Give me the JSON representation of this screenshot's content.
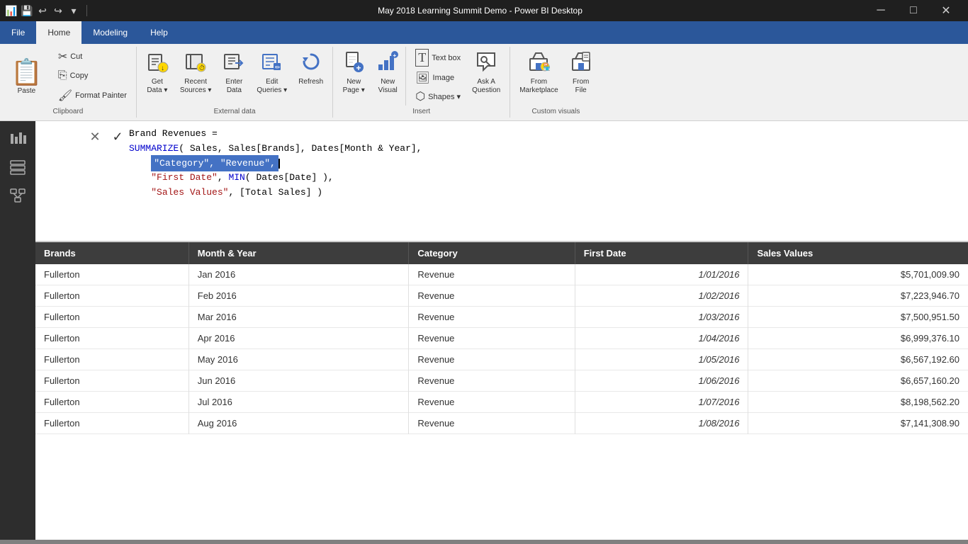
{
  "titleBar": {
    "title": "May 2018 Learning Summit Demo - Power BI Desktop",
    "icons": [
      "📊",
      "💾",
      "↩",
      "↪",
      "▾"
    ],
    "controls": [
      "—",
      "□",
      "✕"
    ]
  },
  "ribbon": {
    "tabs": [
      {
        "label": "File",
        "active": false
      },
      {
        "label": "Home",
        "active": true
      },
      {
        "label": "Modeling",
        "active": false
      },
      {
        "label": "Help",
        "active": false
      }
    ],
    "groups": {
      "clipboard": {
        "label": "Clipboard",
        "paste": "Paste",
        "cut": "✂ Cut",
        "copy": "⎘ Copy",
        "formatPainter": "🖌 Format Painter"
      },
      "externalData": {
        "label": "External data",
        "buttons": [
          {
            "icon": "📄",
            "label": "Get\nData ▾"
          },
          {
            "icon": "🕐",
            "label": "Recent\nSources ▾"
          },
          {
            "icon": "↵",
            "label": "Enter\nData"
          },
          {
            "icon": "✏️",
            "label": "Edit\nQueries ▾"
          },
          {
            "icon": "🔄",
            "label": "Refresh"
          }
        ]
      },
      "insert": {
        "label": "Insert",
        "buttons": [
          {
            "icon": "📄",
            "label": "New\nPage ▾"
          },
          {
            "icon": "📊",
            "label": "New\nVisual"
          },
          {
            "icon": "💬",
            "label": "Ask A\nQuestion"
          }
        ],
        "smallButtons": [
          {
            "icon": "T",
            "label": "Text box"
          },
          {
            "icon": "🖼",
            "label": "Image"
          },
          {
            "icon": "⬡",
            "label": "Shapes ▾"
          }
        ]
      },
      "customVisuals": {
        "label": "Custom visuals",
        "buttons": [
          {
            "icon": "🏪",
            "label": "From\nMarketplace"
          },
          {
            "icon": "📁",
            "label": "From\nFile"
          }
        ]
      }
    }
  },
  "formulaBar": {
    "measureName": "Brand Revenues =",
    "lines": [
      "SUMMARIZE( Sales, Sales[Brands], Dates[Month & Year],",
      "    \"Category\", \"Revenue\",",
      "    \"First Date\", MIN( Dates[Date] ),",
      "    \"Sales Values\", [Total Sales] )"
    ],
    "highlighted": "\"Category\", \"Revenue\","
  },
  "table": {
    "headers": [
      "Brands",
      "Month & Year",
      "Category",
      "First Date",
      "Sales Values"
    ],
    "rows": [
      {
        "brand": "Fullerton",
        "month": "Jan 2016",
        "category": "Revenue",
        "date": "1/01/2016",
        "sales": "$5,701,009.90"
      },
      {
        "brand": "Fullerton",
        "month": "Feb 2016",
        "category": "Revenue",
        "date": "1/02/2016",
        "sales": "$7,223,946.70"
      },
      {
        "brand": "Fullerton",
        "month": "Mar 2016",
        "category": "Revenue",
        "date": "1/03/2016",
        "sales": "$7,500,951.50"
      },
      {
        "brand": "Fullerton",
        "month": "Apr 2016",
        "category": "Revenue",
        "date": "1/04/2016",
        "sales": "$6,999,376.10"
      },
      {
        "brand": "Fullerton",
        "month": "May 2016",
        "category": "Revenue",
        "date": "1/05/2016",
        "sales": "$6,567,192.60"
      },
      {
        "brand": "Fullerton",
        "month": "Jun 2016",
        "category": "Revenue",
        "date": "1/06/2016",
        "sales": "$6,657,160.20"
      },
      {
        "brand": "Fullerton",
        "month": "Jul 2016",
        "category": "Revenue",
        "date": "1/07/2016",
        "sales": "$8,198,562.20"
      },
      {
        "brand": "Fullerton",
        "month": "Aug 2016",
        "category": "Revenue",
        "date": "1/08/2016",
        "sales": "$7,141,308.90"
      }
    ]
  },
  "sidebar": {
    "icons": [
      {
        "name": "report-view",
        "symbol": "📊"
      },
      {
        "name": "data-view",
        "symbol": "▦"
      },
      {
        "name": "model-view",
        "symbol": "⬡"
      }
    ]
  }
}
